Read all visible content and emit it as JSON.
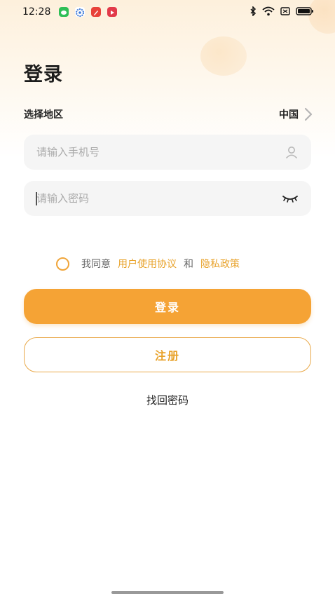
{
  "status_bar": {
    "time": "12:28",
    "app_icons": [
      "wechat-icon",
      "settings-app-icon",
      "red-app-icon",
      "video-app-icon"
    ],
    "right_icons": [
      "bluetooth-icon",
      "wifi-icon",
      "sim-icon",
      "battery-icon"
    ]
  },
  "login": {
    "title": "登录",
    "region": {
      "label": "选择地区",
      "value": "中国"
    },
    "phone": {
      "placeholder": "请输入手机号",
      "value": ""
    },
    "password": {
      "placeholder": "请输入密码",
      "value": ""
    },
    "agreement": {
      "prefix": "我同意",
      "terms_link": "用户使用协议",
      "and": "和",
      "privacy_link": "隐私政策",
      "checked": false
    },
    "login_button": "登录",
    "register_button": "注册",
    "forgot_password": "找回密码"
  },
  "colors": {
    "accent": "#f5a335",
    "link": "#e8a22a",
    "input_bg": "#f5f5f5"
  }
}
